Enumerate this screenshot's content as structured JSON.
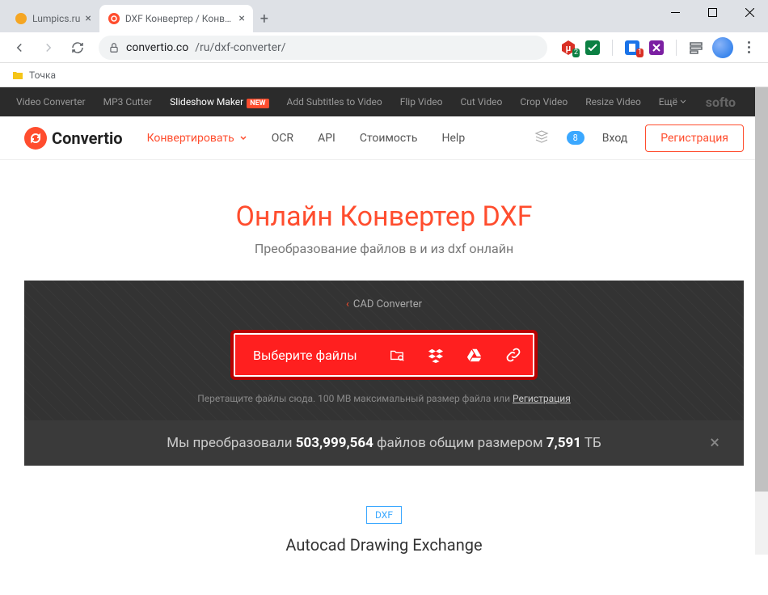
{
  "tabs": {
    "t1": {
      "title": "Lumpics.ru"
    },
    "t2": {
      "title": "DXF Конвертер / Конвертер в D"
    }
  },
  "url": {
    "host": "convertio.co",
    "path": "/ru/dxf-converter/"
  },
  "ext": {
    "badge1": "2",
    "badge2": "1"
  },
  "bookmarks": {
    "b1": "Точка"
  },
  "softo": {
    "i1": "Video Converter",
    "i2": "MP3 Cutter",
    "i3": "Slideshow Maker",
    "new": "NEW",
    "i4": "Add Subtitles to Video",
    "i5": "Flip Video",
    "i6": "Cut Video",
    "i7": "Crop Video",
    "i8": "Resize Video",
    "i9": "Ещё",
    "logo": "softo"
  },
  "nav": {
    "brand": "Convertio",
    "convert": "Конвертировать",
    "ocr": "OCR",
    "api": "API",
    "price": "Стоимость",
    "help": "Help",
    "count": "8",
    "login": "Вход",
    "register": "Регистрация"
  },
  "page": {
    "title": "Онлайн Конвертер DXF",
    "subtitle": "Преобразование файлов в и из dxf онлайн",
    "cad": "CAD Converter",
    "select": "Выберите файлы",
    "hint_pre": "Перетащите файлы сюда. 100 MB максимальный размер файла или ",
    "hint_link": "Регистрация",
    "stats_pre": "Мы преобразовали ",
    "stats_n": "503,999,564",
    "stats_mid": " файлов общим размером ",
    "stats_size": "7,591",
    "stats_unit": " ТБ",
    "dxf": "DXF",
    "format_title": "Autocad Drawing Exchange"
  }
}
